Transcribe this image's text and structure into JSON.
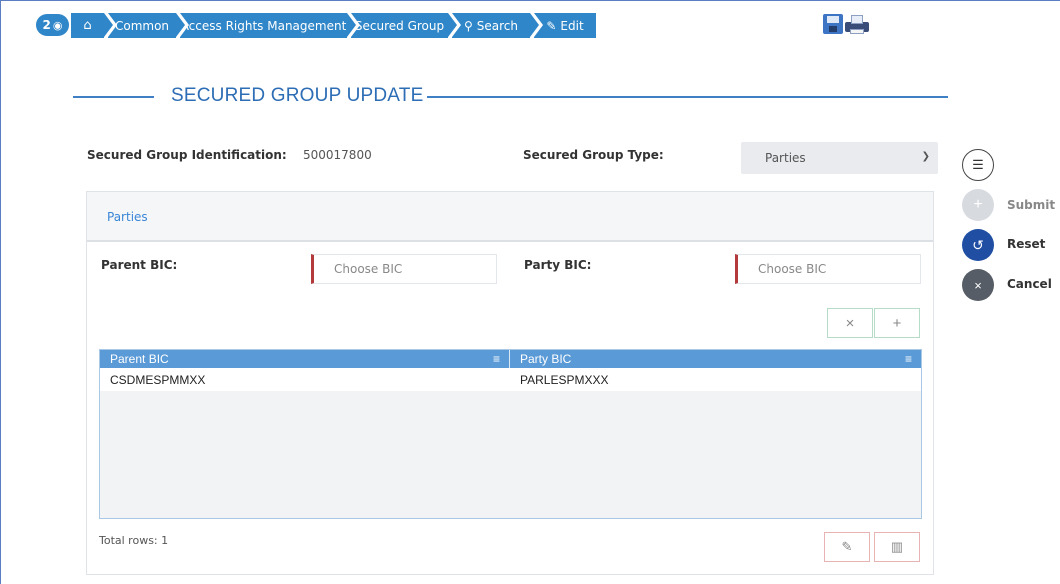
{
  "breadcrumb": {
    "badge_count": "2",
    "items": [
      "Common",
      "Access Rights Management",
      "Secured Group",
      "Search",
      "Edit"
    ]
  },
  "title": "SECURED GROUP UPDATE",
  "form": {
    "id_label": "Secured Group Identification:",
    "id_value": "500017800",
    "type_label": "Secured Group Type:",
    "type_value": "Parties"
  },
  "panel": {
    "tab": "Parties",
    "parent_bic_label": "Parent BIC:",
    "parent_bic_placeholder": "Choose BIC",
    "party_bic_label": "Party BIC:",
    "party_bic_placeholder": "Choose BIC",
    "grid": {
      "columns": [
        "Parent BIC",
        "Party BIC"
      ],
      "rows": [
        [
          "CSDMESPMMXX",
          "PARLESPMXXX"
        ]
      ]
    },
    "total_rows": "Total rows: 1"
  },
  "actions": {
    "submit": "Submit",
    "reset": "Reset",
    "cancel": "Cancel"
  },
  "colors": {
    "primary": "#2f86c8",
    "title": "#2d6db5",
    "grid_header": "#5a9ad7",
    "reset": "#1f4ea3",
    "cancel": "#575d66",
    "required_marker": "#b23a3a"
  },
  "icons": [
    "view-count-eye-icon",
    "home-icon",
    "search-icon",
    "edit-icon",
    "save-icon",
    "print-icon",
    "chevron-down-icon",
    "column-menu-icon",
    "clear-icon",
    "add-icon",
    "edit-pencil-icon",
    "trash-icon",
    "list-icon",
    "plus-icon",
    "reset-undo-icon",
    "close-icon"
  ]
}
